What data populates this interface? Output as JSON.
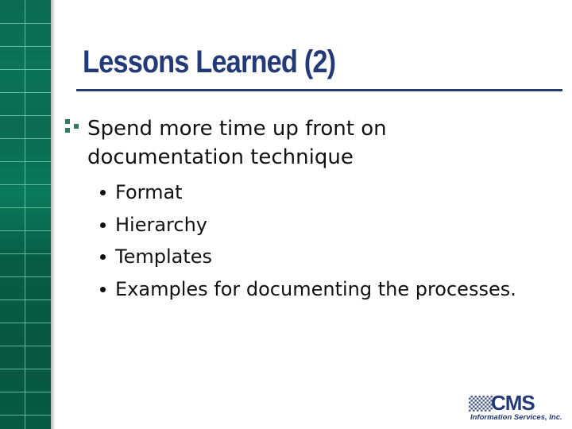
{
  "slide": {
    "title": "Lessons Learned (2)",
    "main_bullet": {
      "text": "Spend more time up front on documentation technique",
      "sub_items": [
        "Format",
        "Hierarchy",
        "Templates",
        "Examples for documenting the processes."
      ]
    }
  },
  "logo": {
    "name": "CMS",
    "subtitle": "Information Services, Inc."
  },
  "theme": {
    "title_color": "#223a78",
    "sidebar_green": "#0a6a50",
    "bullet_green": "#2e7a62"
  }
}
